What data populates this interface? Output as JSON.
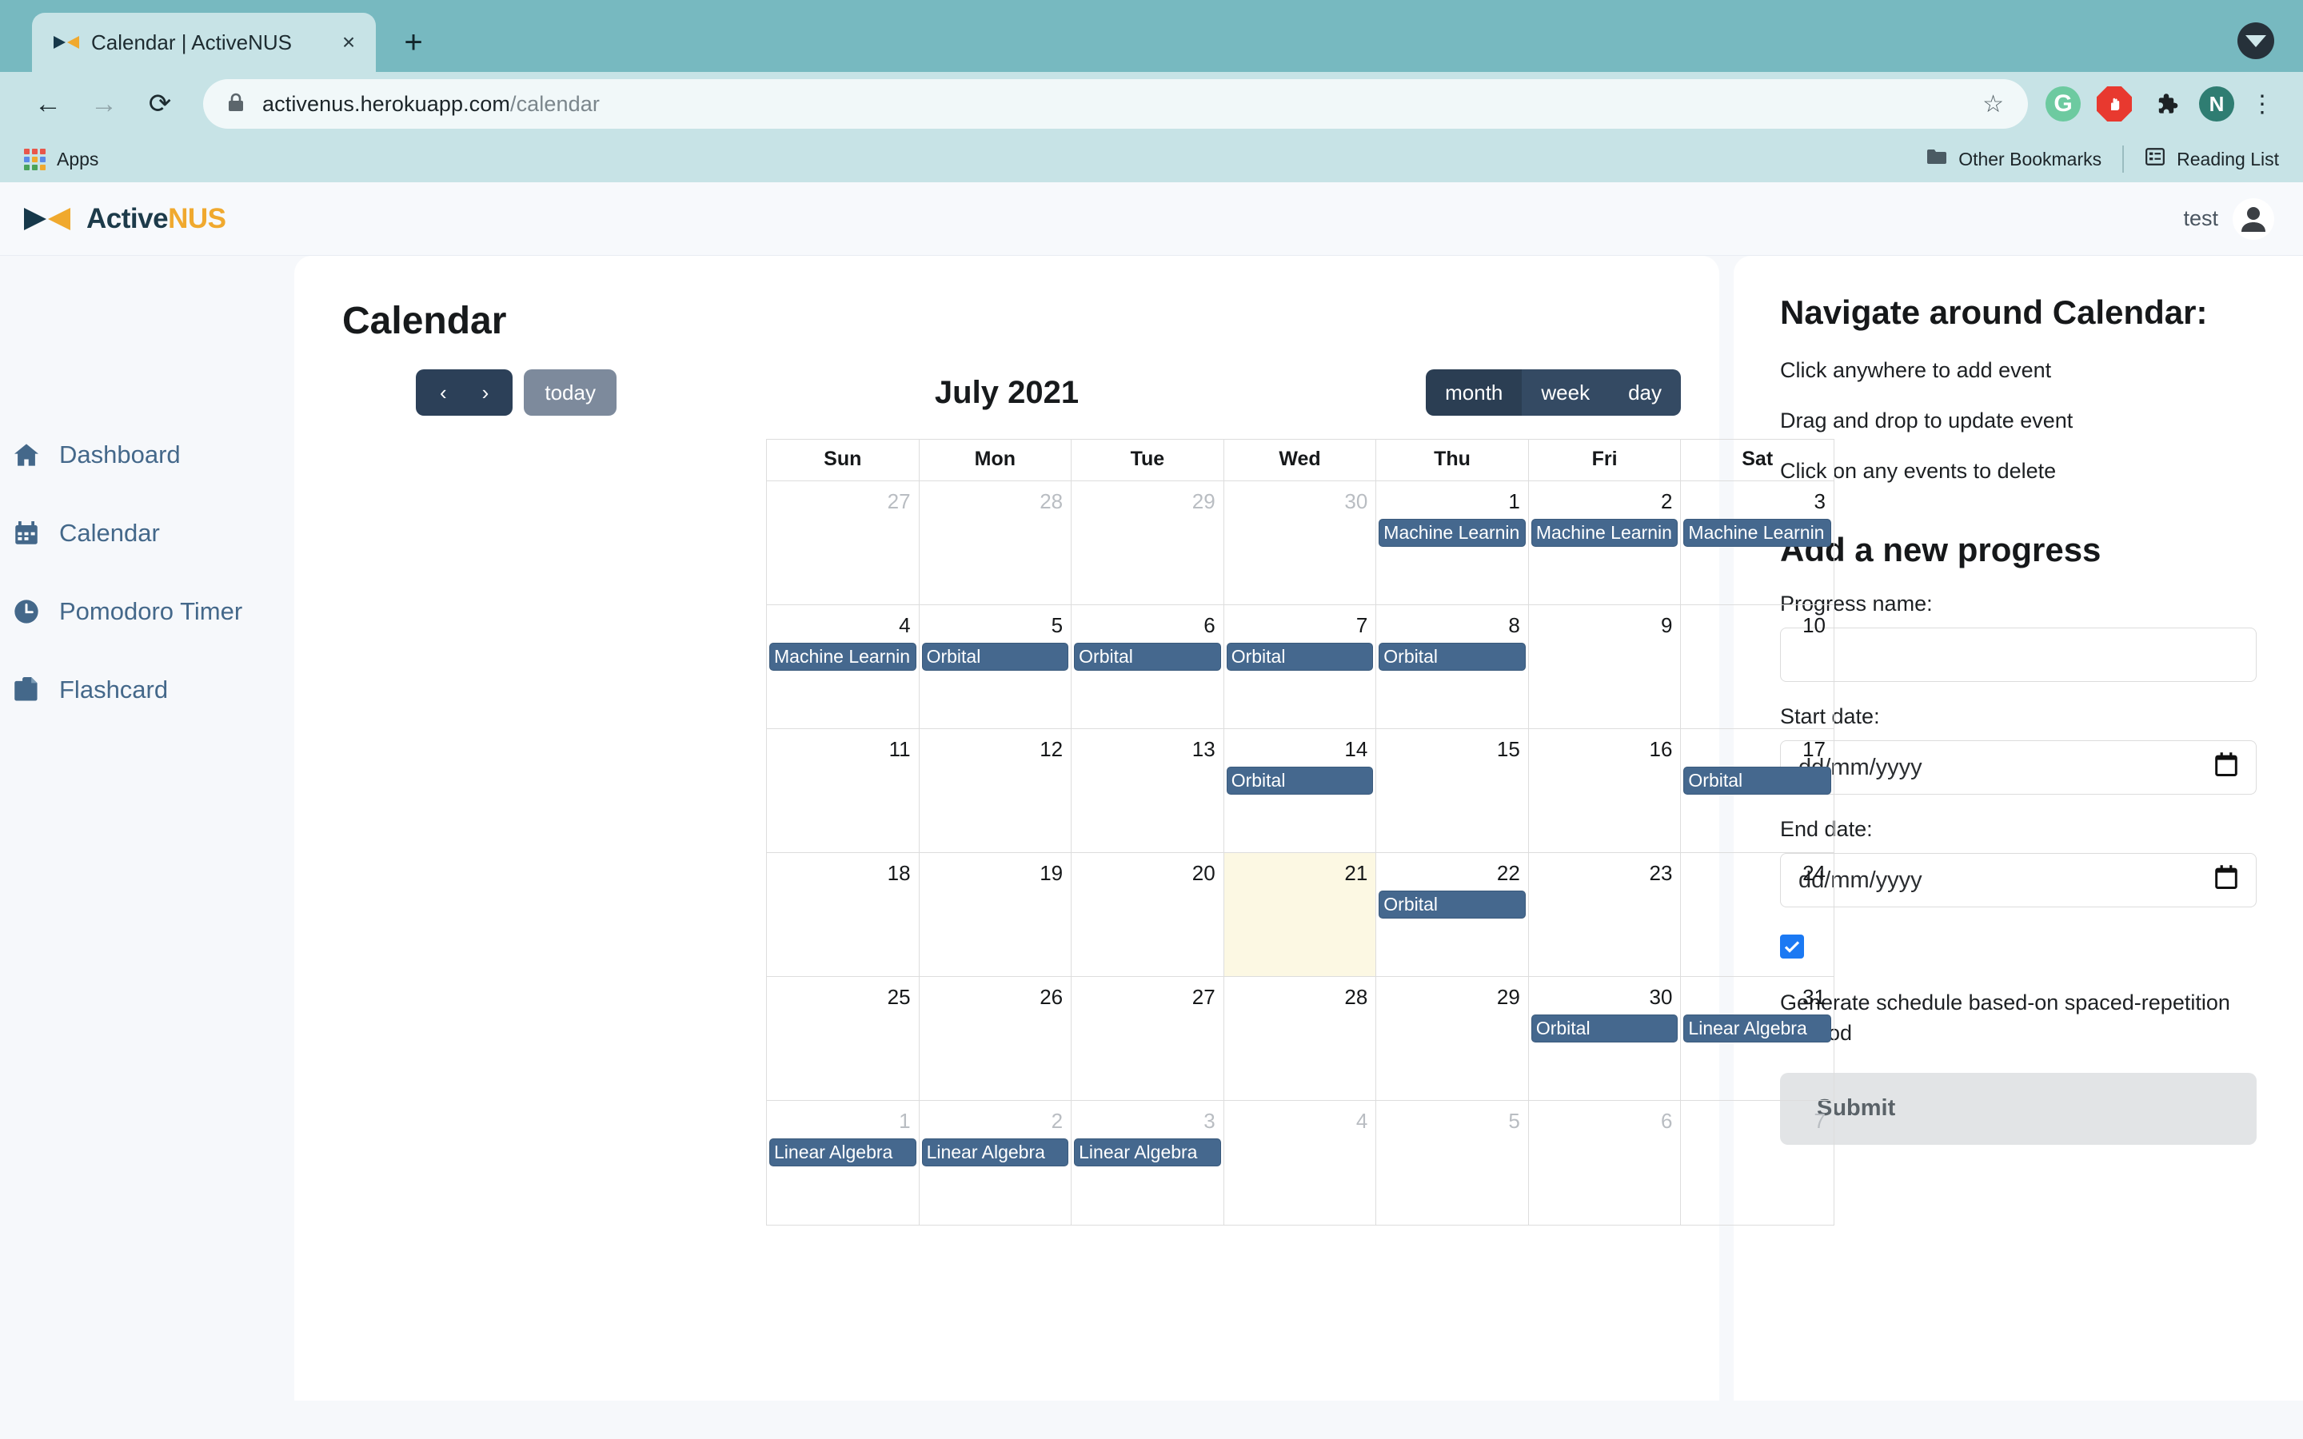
{
  "browser": {
    "tab": {
      "title": "Calendar | ActiveNUS",
      "close_icon": "×",
      "favicon": "activenus-logo-icon"
    },
    "new_tab_label": "+",
    "back_icon": "←",
    "forward_icon": "→",
    "reload_icon": "⟳",
    "lock_icon": "lock-icon",
    "url_host": "activenus.herokuapp.com",
    "url_path": "/calendar",
    "star_icon": "☆",
    "extensions": [
      {
        "name": "grammarly-extension",
        "glyph": "G"
      },
      {
        "name": "adblock-extension",
        "glyph": "✋"
      },
      {
        "name": "extensions-puzzle",
        "glyph": "🧩"
      },
      {
        "name": "profile-avatar",
        "glyph": "N"
      }
    ],
    "menu_icon": "⋮",
    "bookmarks": {
      "apps_label": "Apps",
      "other_bookmarks_label": "Other Bookmarks",
      "reading_list_label": "Reading List"
    }
  },
  "app": {
    "logo_active": "Active",
    "logo_nus": "NUS",
    "username": "test"
  },
  "sidebar": {
    "items": [
      {
        "label": "Dashboard",
        "icon": "home-icon"
      },
      {
        "label": "Calendar",
        "icon": "calendar-icon"
      },
      {
        "label": "Pomodoro Timer",
        "icon": "clock-icon"
      },
      {
        "label": "Flashcard",
        "icon": "flashcard-icon"
      }
    ]
  },
  "main": {
    "page_title": "Calendar",
    "toolbar": {
      "prev_label": "‹",
      "next_label": "›",
      "today_label": "today",
      "title": "July 2021",
      "views": [
        {
          "label": "month",
          "active": true
        },
        {
          "label": "week",
          "active": false
        },
        {
          "label": "day",
          "active": false
        }
      ]
    },
    "weekdays": [
      "Sun",
      "Mon",
      "Tue",
      "Wed",
      "Thu",
      "Fri",
      "Sat"
    ],
    "event_color": "#45688e",
    "today_cell_color": "#fcf8e3",
    "weeks": [
      [
        {
          "day": "27",
          "other": true,
          "events": []
        },
        {
          "day": "28",
          "other": true,
          "events": []
        },
        {
          "day": "29",
          "other": true,
          "events": []
        },
        {
          "day": "30",
          "other": true,
          "events": []
        },
        {
          "day": "1",
          "other": false,
          "events": [
            "Machine Learnin"
          ]
        },
        {
          "day": "2",
          "other": false,
          "events": [
            "Machine Learnin"
          ]
        },
        {
          "day": "3",
          "other": false,
          "events": [
            "Machine Learnin"
          ]
        }
      ],
      [
        {
          "day": "4",
          "other": false,
          "events": [
            "Machine Learnin"
          ]
        },
        {
          "day": "5",
          "other": false,
          "events": [
            "Orbital"
          ]
        },
        {
          "day": "6",
          "other": false,
          "events": [
            "Orbital"
          ]
        },
        {
          "day": "7",
          "other": false,
          "events": [
            "Orbital"
          ]
        },
        {
          "day": "8",
          "other": false,
          "events": [
            "Orbital"
          ]
        },
        {
          "day": "9",
          "other": false,
          "events": []
        },
        {
          "day": "10",
          "other": false,
          "events": []
        }
      ],
      [
        {
          "day": "11",
          "other": false,
          "events": []
        },
        {
          "day": "12",
          "other": false,
          "events": []
        },
        {
          "day": "13",
          "other": false,
          "events": []
        },
        {
          "day": "14",
          "other": false,
          "events": [
            "Orbital"
          ]
        },
        {
          "day": "15",
          "other": false,
          "events": []
        },
        {
          "day": "16",
          "other": false,
          "events": []
        },
        {
          "day": "17",
          "other": false,
          "events": [
            "Orbital"
          ]
        }
      ],
      [
        {
          "day": "18",
          "other": false,
          "events": []
        },
        {
          "day": "19",
          "other": false,
          "events": []
        },
        {
          "day": "20",
          "other": false,
          "events": []
        },
        {
          "day": "21",
          "other": false,
          "today": true,
          "events": []
        },
        {
          "day": "22",
          "other": false,
          "events": [
            "Orbital"
          ]
        },
        {
          "day": "23",
          "other": false,
          "events": []
        },
        {
          "day": "24",
          "other": false,
          "events": []
        }
      ],
      [
        {
          "day": "25",
          "other": false,
          "events": []
        },
        {
          "day": "26",
          "other": false,
          "events": []
        },
        {
          "day": "27",
          "other": false,
          "events": []
        },
        {
          "day": "28",
          "other": false,
          "events": []
        },
        {
          "day": "29",
          "other": false,
          "events": []
        },
        {
          "day": "30",
          "other": false,
          "events": [
            "Orbital"
          ]
        },
        {
          "day": "31",
          "other": false,
          "events": [
            "Linear Algebra"
          ]
        }
      ],
      [
        {
          "day": "1",
          "other": true,
          "events": [
            "Linear Algebra"
          ]
        },
        {
          "day": "2",
          "other": true,
          "events": [
            "Linear Algebra"
          ]
        },
        {
          "day": "3",
          "other": true,
          "events": [
            "Linear Algebra"
          ]
        },
        {
          "day": "4",
          "other": true,
          "events": []
        },
        {
          "day": "5",
          "other": true,
          "events": []
        },
        {
          "day": "6",
          "other": true,
          "events": []
        },
        {
          "day": "7",
          "other": true,
          "events": []
        }
      ]
    ]
  },
  "rightpanel": {
    "nav_heading": "Navigate around Calendar:",
    "tips": [
      "Click anywhere to add event",
      "Drag and drop to update event",
      "Click on any events to delete"
    ],
    "form_heading": "Add a new progress",
    "progress_name_label": "Progress name:",
    "progress_name_value": "",
    "start_date_label": "Start date:",
    "start_date_placeholder": "dd/mm/yyyy",
    "end_date_label": "End date:",
    "end_date_placeholder": "dd/mm/yyyy",
    "checkbox_checked": true,
    "checkbox_label": "Generate schedule based-on spaced-repetition method",
    "submit_label": "Submit"
  }
}
